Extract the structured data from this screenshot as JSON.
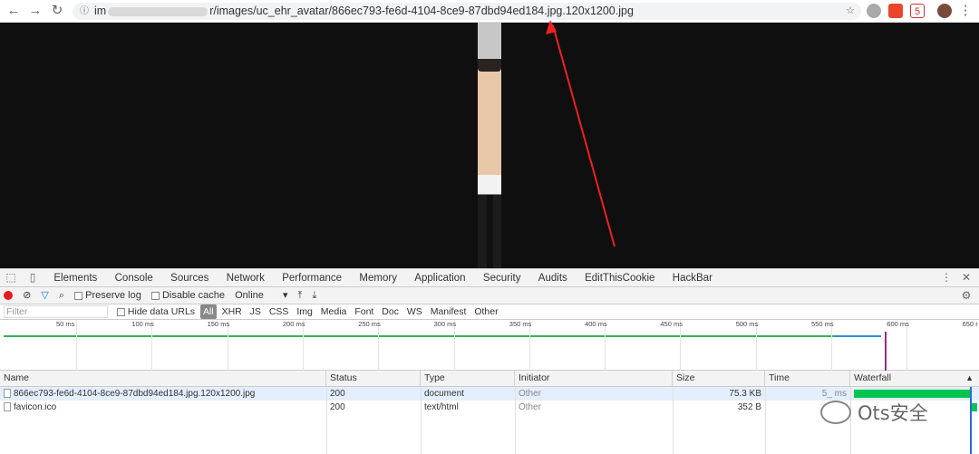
{
  "browser": {
    "url_prefix": "im",
    "url_suffix": "r/images/uc_ehr_avatar/866ec793-fe6d-4104-8ce9-87dbd94ed184.jpg.120x1200.jpg",
    "ext_badge": "5"
  },
  "devtools": {
    "tabs": [
      "Elements",
      "Console",
      "Sources",
      "Network",
      "Performance",
      "Memory",
      "Application",
      "Security",
      "Audits",
      "EditThisCookie",
      "HackBar"
    ],
    "active_tab": "Network",
    "toolbar": {
      "preserve_log": "Preserve log",
      "disable_cache": "Disable cache",
      "throttle": "Online"
    },
    "filter": {
      "placeholder": "Filter",
      "hide_data_urls": "Hide data URLs",
      "types": [
        "All",
        "XHR",
        "JS",
        "CSS",
        "Img",
        "Media",
        "Font",
        "Doc",
        "WS",
        "Manifest",
        "Other"
      ]
    },
    "timeline_ticks": [
      "50 ms",
      "100 ms",
      "150 ms",
      "200 ms",
      "250 ms",
      "300 ms",
      "350 ms",
      "400 ms",
      "450 ms",
      "500 ms",
      "550 ms",
      "600 ms",
      "650 r"
    ],
    "columns": [
      "Name",
      "Status",
      "Type",
      "Initiator",
      "Size",
      "Time",
      "Waterfall"
    ],
    "rows": [
      {
        "name": "866ec793-fe6d-4104-8ce9-87dbd94ed184.jpg.120x1200.jpg",
        "status": "200",
        "type": "document",
        "initiator": "Other",
        "size": "75.3 KB",
        "time": "5_ ms"
      },
      {
        "name": "favicon.ico",
        "status": "200",
        "type": "text/html",
        "initiator": "Other",
        "size": "352 B",
        "time": ""
      }
    ]
  },
  "watermark": "Ots安全"
}
